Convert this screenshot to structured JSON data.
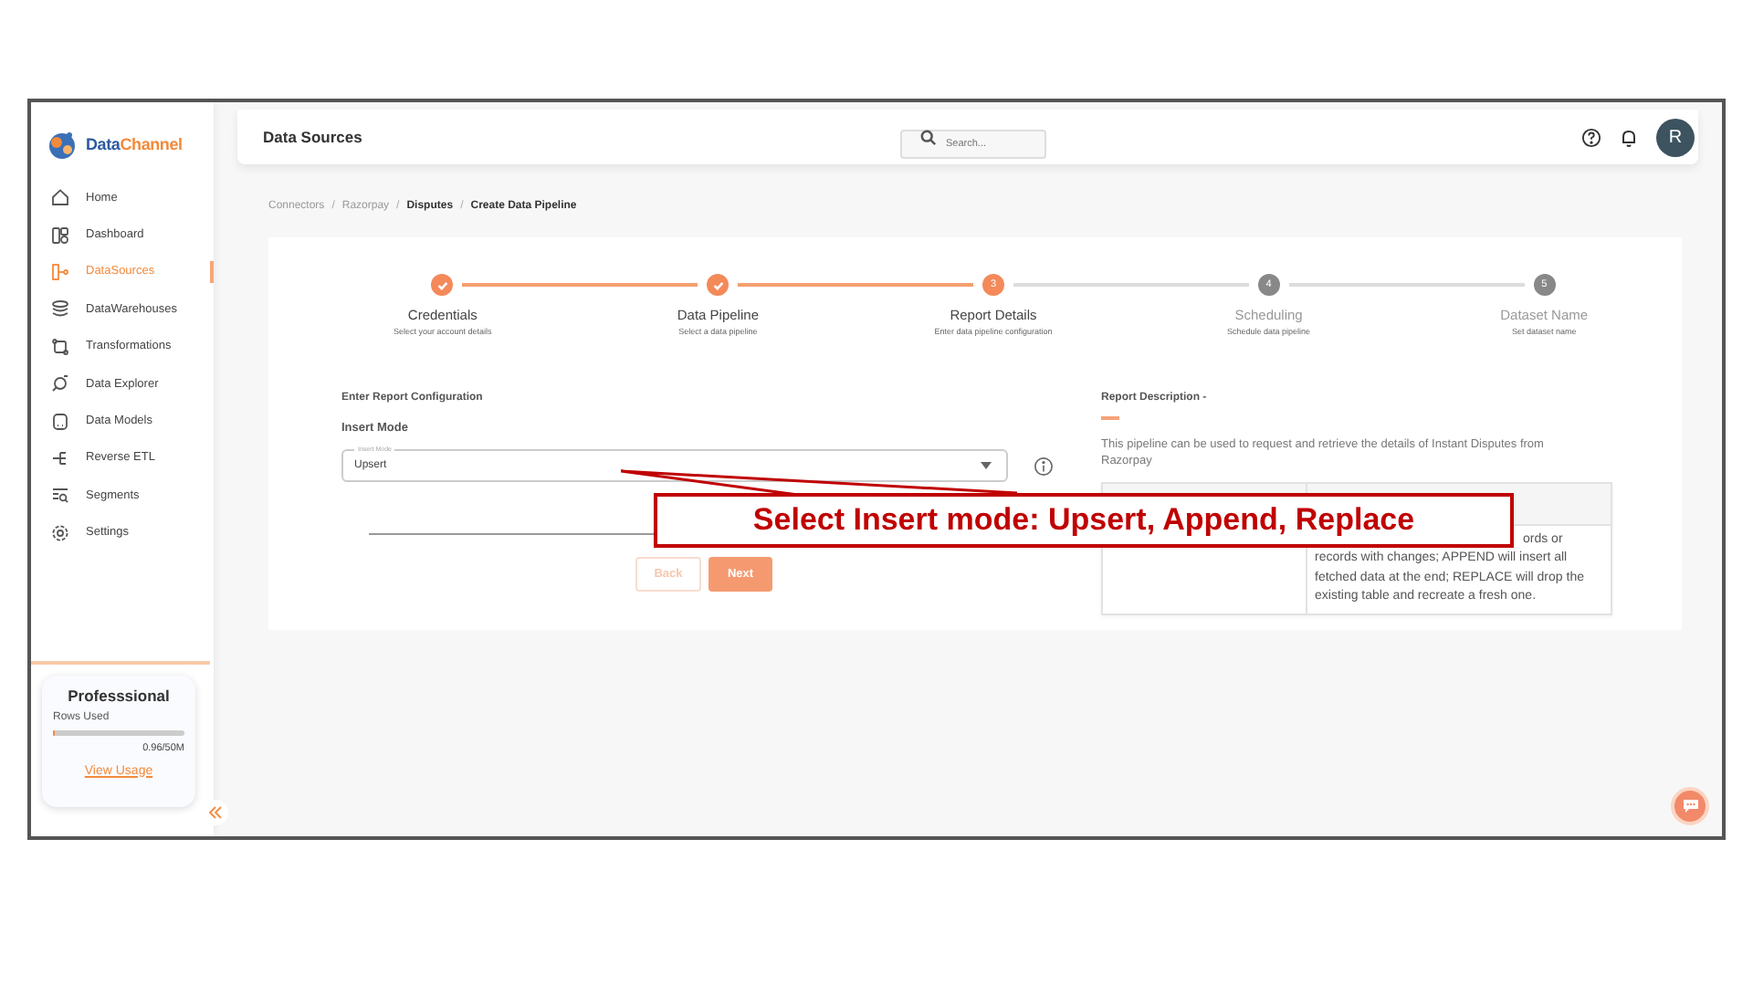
{
  "sidebar": {
    "logo": {
      "text_1": "Data",
      "text_2": "Channel"
    },
    "items": [
      {
        "label": "Home",
        "selected": false
      },
      {
        "label": "Dashboard",
        "selected": false
      },
      {
        "label": "DataSources",
        "selected": true
      },
      {
        "label": "DataWarehouses",
        "selected": false
      },
      {
        "label": "Transformations",
        "selected": false
      },
      {
        "label": "Data Explorer",
        "selected": false
      },
      {
        "label": "Data Models",
        "selected": false
      },
      {
        "label": "Reverse ETL",
        "selected": false
      },
      {
        "label": "Segments",
        "selected": false
      },
      {
        "label": "Settings",
        "selected": false
      }
    ],
    "plan": {
      "name": "Professsional",
      "rows_label": "Rows Used",
      "level": 0.02,
      "reading": "0.96/50M",
      "link": "View Usage"
    }
  },
  "header": {
    "title": "Data Sources",
    "search": {
      "placeholder": "Search..."
    },
    "avatar": "R"
  },
  "breadcrumb": [
    {
      "label": "Connectors",
      "active": false
    },
    {
      "separator": "/",
      "label": "Razorpay",
      "active": false
    },
    {
      "separator": "/",
      "label": "Disputes",
      "active": true
    },
    {
      "separator": "/",
      "label": "Create Data Pipeline",
      "active": true
    }
  ],
  "steps": [
    {
      "title": "Credentials",
      "subtitle": "Select your account details",
      "kind": "done"
    },
    {
      "title": "Data Pipeline",
      "subtitle": "Select a data pipeline",
      "kind": "done"
    },
    {
      "title": "Report Details",
      "subtitle": "Enter data pipeline configuration",
      "kind": "current",
      "number": "3"
    },
    {
      "title": "Scheduling",
      "subtitle": "Schedule data pipeline",
      "kind": "pending",
      "number": "4"
    },
    {
      "title": "Dataset Name",
      "subtitle": "Set dataset name",
      "kind": "pending",
      "number": "5"
    }
  ],
  "form": {
    "heading": "Enter Report Configuration",
    "field_label": "Insert Mode",
    "select": {
      "label": "Insert Mode",
      "value": "Upsert"
    },
    "buttons": [
      {
        "label": "Back",
        "kind": "secondary"
      },
      {
        "label": "Next",
        "kind": "primary"
      }
    ]
  },
  "description": {
    "title": "Report Description -",
    "text": "This pipeline can be used to request and retrieve the details of Instant Disputes from Razorpay",
    "table": {
      "cell_fragment": "ords or",
      "cell_text": "records with changes; APPEND will insert all fetched data at the end; REPLACE will drop the existing table and recreate a fresh one."
    }
  },
  "annotation": {
    "text": "Select Insert mode: Upsert, Append, Replace"
  }
}
